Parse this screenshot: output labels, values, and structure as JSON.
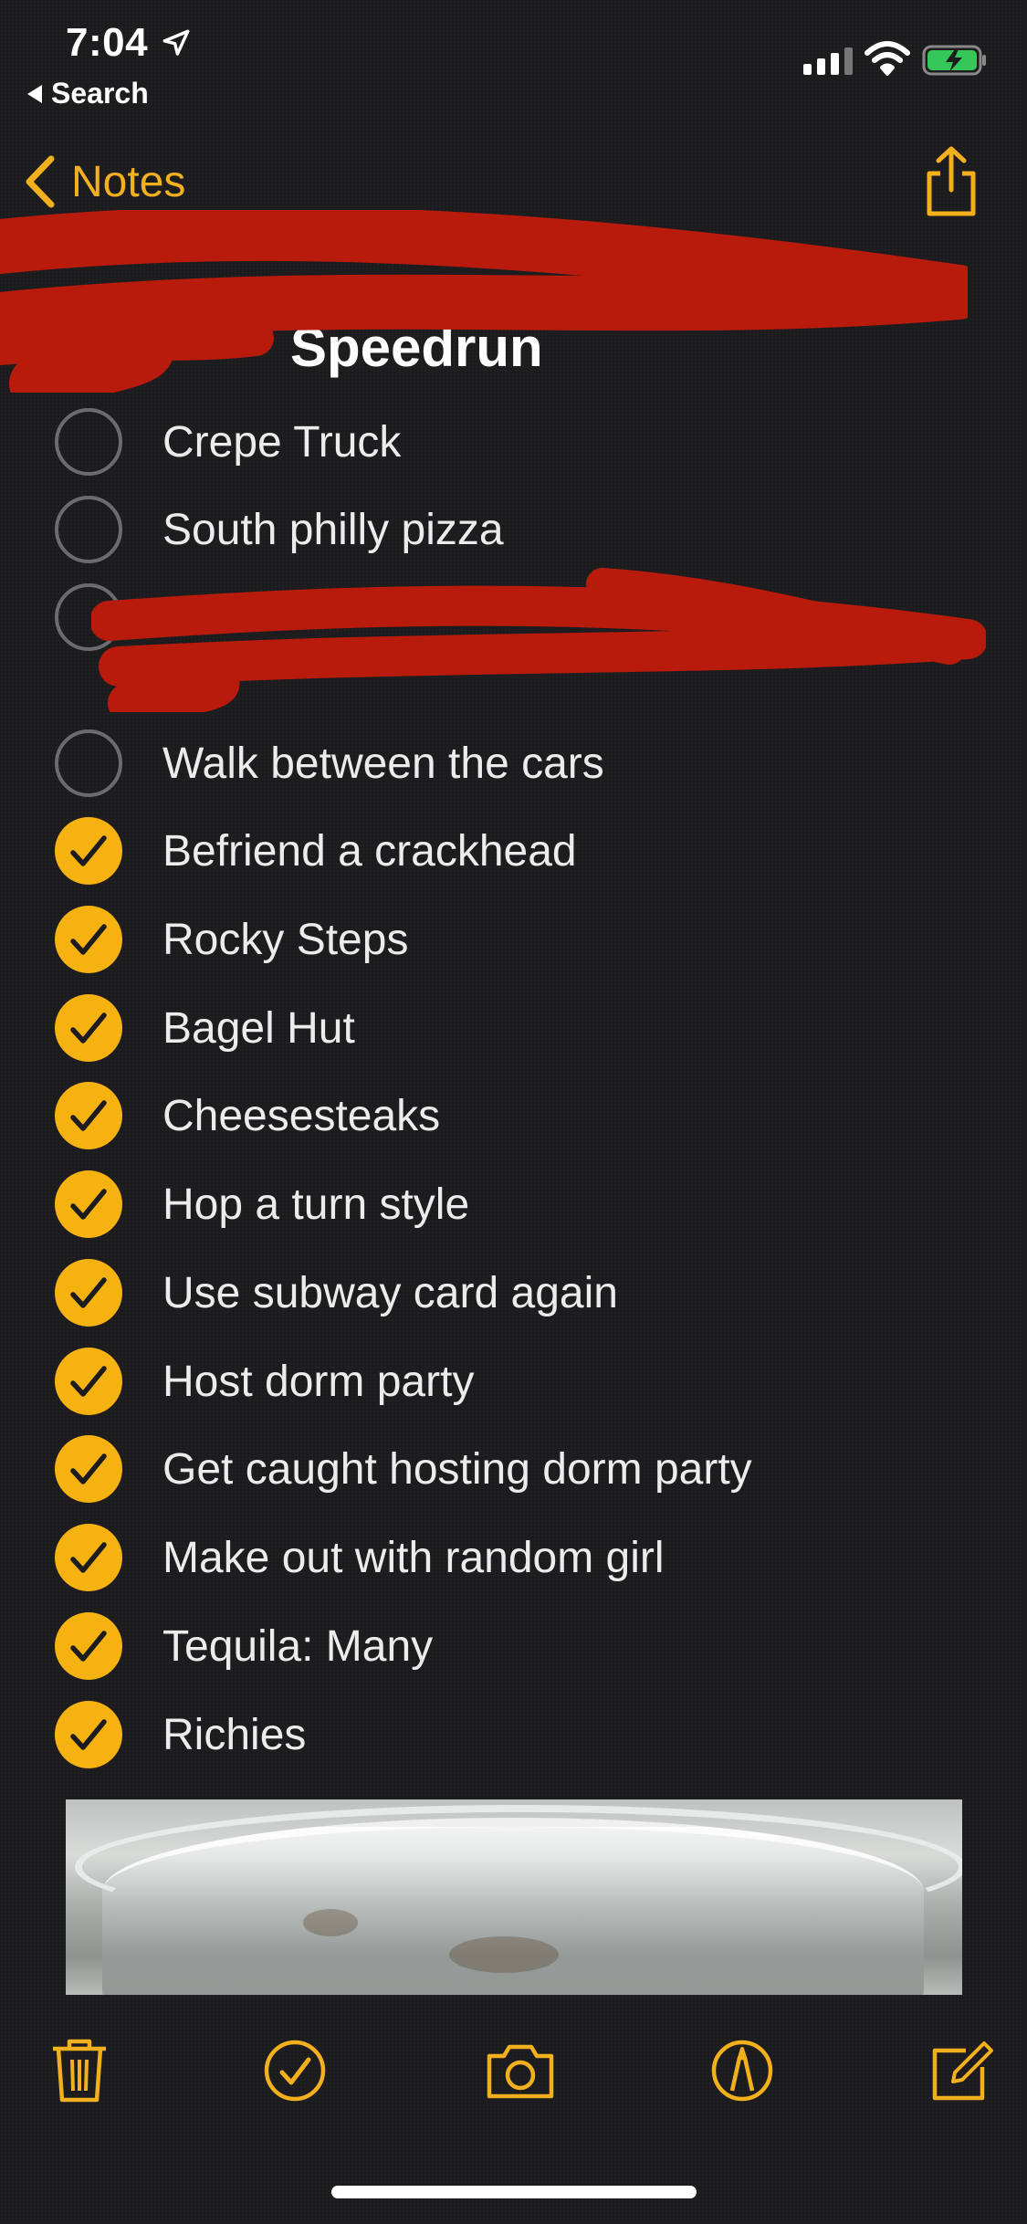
{
  "status_bar": {
    "time": "7:04",
    "back_label": "Search"
  },
  "nav": {
    "back_label": "Notes"
  },
  "note": {
    "title": "Speedrun",
    "items": [
      {
        "label": "Crepe Truck",
        "checked": false
      },
      {
        "label": "South philly pizza",
        "checked": false
      },
      {
        "label": "",
        "checked": false,
        "redacted": true
      },
      {
        "label": "Walk between the cars",
        "checked": false
      },
      {
        "label": "Befriend a crackhead",
        "checked": true
      },
      {
        "label": "Rocky Steps",
        "checked": true
      },
      {
        "label": "Bagel Hut",
        "checked": true
      },
      {
        "label": "Cheesesteaks",
        "checked": true
      },
      {
        "label": "Hop a turn style",
        "checked": true
      },
      {
        "label": "Use subway card again",
        "checked": true
      },
      {
        "label": "Host dorm party",
        "checked": true
      },
      {
        "label": "Get caught hosting dorm party",
        "checked": true
      },
      {
        "label": "Make out with random girl",
        "checked": true
      },
      {
        "label": "Tequila: Many",
        "checked": true
      },
      {
        "label": "Richies",
        "checked": true
      }
    ]
  },
  "toolbar": {
    "icons": [
      "trash-icon",
      "checklist-icon",
      "camera-icon",
      "markup-icon",
      "compose-icon"
    ]
  },
  "colors": {
    "accent": "#f5b211",
    "background": "#1c1c1e",
    "redaction": "#b81a0c"
  }
}
